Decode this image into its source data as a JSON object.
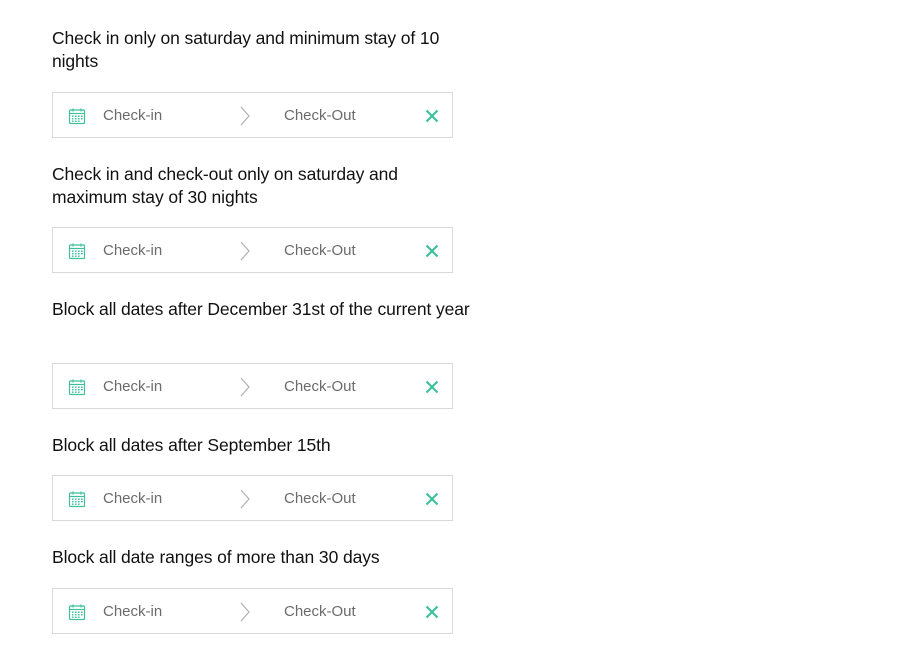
{
  "accent_color": "#3cc19b",
  "placeholders": {
    "checkin": "Check-in",
    "checkout": "Check-Out"
  },
  "sections": [
    {
      "title": "Check in only on saturday and minimum stay of 10 nights"
    },
    {
      "title": "Check in and check-out only on saturday and maximum stay of 30 nights"
    },
    {
      "title": "Block all dates after December 31st of the current year"
    },
    {
      "title": "Block all dates after September 15th"
    },
    {
      "title": "Block all date ranges of more than 30 days"
    }
  ],
  "icons": {
    "calendar": "calendar-icon",
    "arrow": "chevron-right-icon",
    "clear": "close-icon"
  }
}
